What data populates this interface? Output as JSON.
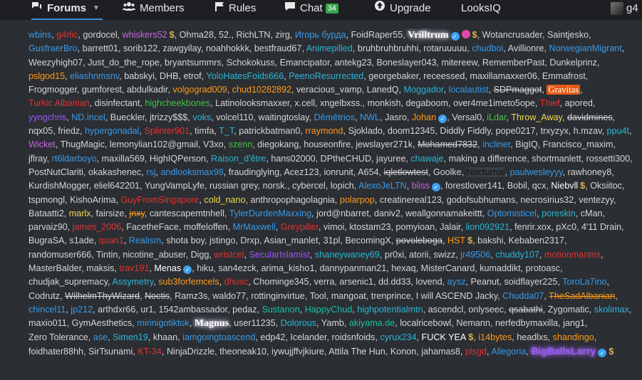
{
  "nav": {
    "items": [
      {
        "id": "forums",
        "label": "Forums",
        "icon": "chat-bubbles-icon"
      },
      {
        "id": "members",
        "label": "Members",
        "icon": "users-icon"
      },
      {
        "id": "rules",
        "label": "Rules",
        "icon": "flag-icon"
      },
      {
        "id": "chat",
        "label": "Chat",
        "icon": "comment-icon",
        "badge": "34"
      },
      {
        "id": "upgrade",
        "label": "Upgrade",
        "icon": "upload-icon"
      },
      {
        "id": "looksiq",
        "label": "LooksIQ"
      }
    ],
    "user_label": "g4"
  },
  "colors": {
    "blue": "#3a9ae8",
    "cyan": "#2ab7d6",
    "red": "#e5322f",
    "orange": "#ff9a1a",
    "yellow": "#f2d94e",
    "purple": "#9b59f5",
    "pink": "#c568dd",
    "green": "#43c04a",
    "teal": "#17c0a7",
    "grey": "#d6d6d6"
  },
  "online": [
    {
      "t": "wbins",
      "c": "blue"
    },
    {
      "t": "g4rlic",
      "c": "red"
    },
    {
      "t": "gordocel",
      "c": "grey"
    },
    {
      "t": "whiskers52",
      "c": "pink",
      "dollar": true
    },
    {
      "t": "Ohma28",
      "c": "grey"
    },
    {
      "t": "52.",
      "c": "grey"
    },
    {
      "t": "RichLTN",
      "c": "grey"
    },
    {
      "t": "zirg",
      "c": "grey"
    },
    {
      "t": "Игорь бурда",
      "c": "blue"
    },
    {
      "t": "FoidRaper55",
      "c": "grey"
    },
    {
      "t": "Vrilltrum",
      "c": "white",
      "glow": true,
      "verified": true,
      "dot": true,
      "dollar": true
    },
    {
      "t": "Wotancrusader",
      "c": "grey"
    },
    {
      "t": "Saintjesko",
      "c": "grey"
    },
    {
      "t": "GusfraerBro",
      "c": "blue"
    },
    {
      "t": "barrett01",
      "c": "grey"
    },
    {
      "t": "sorib122",
      "c": "grey"
    },
    {
      "t": "zawgyilay",
      "c": "grey"
    },
    {
      "t": "noahhokkk",
      "c": "grey"
    },
    {
      "t": "bestfraud67",
      "c": "grey"
    },
    {
      "t": "Animepilled",
      "c": "cyan"
    },
    {
      "t": "bruhbruhbruhhi",
      "c": "grey"
    },
    {
      "t": "rotaruuuuu",
      "c": "grey"
    },
    {
      "t": "chudboi",
      "c": "blue"
    },
    {
      "t": "Avillionre",
      "c": "grey"
    },
    {
      "t": "NorwegianMigrant",
      "c": "blue"
    },
    {
      "t": "Weezyhigh07",
      "c": "grey"
    },
    {
      "t": "Just_do_the_rope",
      "c": "grey"
    },
    {
      "t": "bryantsummrs",
      "c": "grey"
    },
    {
      "t": "Schokokuss",
      "c": "grey"
    },
    {
      "t": "Emancipator",
      "c": "grey"
    },
    {
      "t": "antekg23",
      "c": "grey"
    },
    {
      "t": "Boneslayer043",
      "c": "grey"
    },
    {
      "t": "mitereew",
      "c": "grey"
    },
    {
      "t": "RememberPast",
      "c": "grey"
    },
    {
      "t": "Dunkelprinz",
      "c": "grey"
    },
    {
      "t": "pslgod15",
      "c": "orange"
    },
    {
      "t": "eliashnmsnv",
      "c": "blue"
    },
    {
      "t": "babskyi",
      "c": "grey"
    },
    {
      "t": "DHB",
      "c": "grey"
    },
    {
      "t": "etrof",
      "c": "grey"
    },
    {
      "t": "YoloHatesFoids666",
      "c": "cyan"
    },
    {
      "t": "PeenoResurrected",
      "c": "cyan"
    },
    {
      "t": "georgebaker",
      "c": "grey"
    },
    {
      "t": "receessed",
      "c": "grey"
    },
    {
      "t": "maxillamaxxer06",
      "c": "grey"
    },
    {
      "t": "Emmafrost",
      "c": "grey"
    },
    {
      "t": "Frogmogger",
      "c": "grey"
    },
    {
      "t": "gumforest",
      "c": "grey"
    },
    {
      "t": "abdulkadir",
      "c": "grey"
    },
    {
      "t": "volgograd009",
      "c": "orange"
    },
    {
      "t": "chud10282892",
      "c": "orange"
    },
    {
      "t": "veracious_vamp",
      "c": "grey"
    },
    {
      "t": "LanedQ",
      "c": "grey"
    },
    {
      "t": "Moggador",
      "c": "cyan"
    },
    {
      "t": "localautist",
      "c": "blue"
    },
    {
      "t": "SDPmaggot",
      "c": "grey",
      "strike": true
    },
    {
      "t": "Gravitas",
      "c": "white",
      "gravitas": true
    },
    {
      "t": "Turkic Albanian",
      "c": "red"
    },
    {
      "t": "disinfectant",
      "c": "grey"
    },
    {
      "t": "highcheekbones",
      "c": "green"
    },
    {
      "t": "Latinolooksmaxxer",
      "c": "grey"
    },
    {
      "t": "x.cell",
      "c": "grey"
    },
    {
      "t": "xngelbxss.",
      "c": "grey"
    },
    {
      "t": "monkish",
      "c": "grey"
    },
    {
      "t": "degaboom",
      "c": "grey"
    },
    {
      "t": "over4me1imeto5ope",
      "c": "grey"
    },
    {
      "t": "Thief",
      "c": "red"
    },
    {
      "t": "apored",
      "c": "grey"
    },
    {
      "t": "yyngchris",
      "c": "purple"
    },
    {
      "t": "ND.incel",
      "c": "blue"
    },
    {
      "t": "Bueckler",
      "c": "grey"
    },
    {
      "t": "jtrizzy$$$",
      "c": "grey"
    },
    {
      "t": "voks",
      "c": "cyan"
    },
    {
      "t": "volcel110",
      "c": "grey"
    },
    {
      "t": "waitingtoslay",
      "c": "grey"
    },
    {
      "t": "Dēmētrios",
      "c": "blue"
    },
    {
      "t": "NWL",
      "c": "blue"
    },
    {
      "t": "Jasro",
      "c": "grey"
    },
    {
      "t": "Johan",
      "c": "orange",
      "verified": true
    },
    {
      "t": "Versal0",
      "c": "grey"
    },
    {
      "t": "iLdar",
      "c": "green"
    },
    {
      "t": "Throw_Away",
      "c": "yellow"
    },
    {
      "t": "davidmines",
      "c": "grey",
      "strike": true
    },
    {
      "t": "nqx05",
      "c": "grey"
    },
    {
      "t": "friedz",
      "c": "grey"
    },
    {
      "t": "hypergonadal",
      "c": "blue"
    },
    {
      "t": "Splinter901",
      "c": "red"
    },
    {
      "t": "timfa",
      "c": "grey"
    },
    {
      "t": "T_T",
      "c": "cyan"
    },
    {
      "t": "patrickbatman0",
      "c": "grey"
    },
    {
      "t": "rraymond",
      "c": "orange"
    },
    {
      "t": "Sjoklado",
      "c": "grey"
    },
    {
      "t": "doom12345",
      "c": "grey"
    },
    {
      "t": "Diddly Fiddly",
      "c": "grey"
    },
    {
      "t": "pope0217",
      "c": "grey"
    },
    {
      "t": "trxyzyx",
      "c": "grey"
    },
    {
      "t": "h.mzav",
      "c": "grey"
    },
    {
      "t": "ppu4t",
      "c": "cyan"
    },
    {
      "t": "Wicket",
      "c": "pink"
    },
    {
      "t": "ThugMagic",
      "c": "grey"
    },
    {
      "t": "lemonylian102@gmail",
      "c": "grey"
    },
    {
      "t": "V3xo",
      "c": "grey"
    },
    {
      "t": "szenn",
      "c": "green"
    },
    {
      "t": "diegokang",
      "c": "grey"
    },
    {
      "t": "houseonfire",
      "c": "grey"
    },
    {
      "t": "jewslayer271k",
      "c": "grey"
    },
    {
      "t": "Mohamed7832",
      "c": "grey",
      "strike": true
    },
    {
      "t": "incliner",
      "c": "blue"
    },
    {
      "t": "BigIQ",
      "c": "grey"
    },
    {
      "t": "Francisco_maxim",
      "c": "grey"
    },
    {
      "t": "jflray",
      "c": "grey"
    },
    {
      "t": "rt6ldarboyo",
      "c": "blue"
    },
    {
      "t": "maxilla569",
      "c": "grey"
    },
    {
      "t": "HighIQPerson",
      "c": "grey"
    },
    {
      "t": "Raison_d'être",
      "c": "cyan"
    },
    {
      "t": "hans02000",
      "c": "grey"
    },
    {
      "t": "DPtheCHUD",
      "c": "grey"
    },
    {
      "t": "jayuree",
      "c": "grey"
    },
    {
      "t": "chawaje",
      "c": "cyan"
    },
    {
      "t": "making a difference",
      "c": "grey"
    },
    {
      "t": "shortmanlett",
      "c": "grey"
    },
    {
      "t": "rossetti300",
      "c": "grey"
    },
    {
      "t": "PostNutClariti",
      "c": "grey"
    },
    {
      "t": "okakashenec",
      "c": "grey"
    },
    {
      "t": "rsj",
      "c": "blue"
    },
    {
      "t": "andlooksmax98",
      "c": "blue"
    },
    {
      "t": "fraudinglying",
      "c": "grey"
    },
    {
      "t": "Acez123",
      "c": "grey"
    },
    {
      "t": "ionrunit",
      "c": "grey"
    },
    {
      "t": "A654",
      "c": "grey"
    },
    {
      "t": "iqletlowtest",
      "c": "grey",
      "strike": true
    },
    {
      "t": "Goolke",
      "c": "grey"
    },
    {
      "t": "Nocturnal",
      "c": "black"
    },
    {
      "t": "paulwesleyyy",
      "c": "blue"
    },
    {
      "t": "rawhoney8",
      "c": "grey"
    },
    {
      "t": "KurdishMogger",
      "c": "grey"
    },
    {
      "t": "eliel642201",
      "c": "grey"
    },
    {
      "t": "YungVampLyfe",
      "c": "grey"
    },
    {
      "t": "russian grey",
      "c": "grey"
    },
    {
      "t": "norsk.",
      "c": "grey"
    },
    {
      "t": "cybercel",
      "c": "grey"
    },
    {
      "t": "lopich",
      "c": "grey"
    },
    {
      "t": "AlexoJeLTN",
      "c": "blue"
    },
    {
      "t": "bliss",
      "c": "pink",
      "verified": true
    },
    {
      "t": "forestlover141",
      "c": "grey"
    },
    {
      "t": "Bobil",
      "c": "grey"
    },
    {
      "t": "qcx",
      "c": "grey"
    },
    {
      "t": "Niebvll",
      "c": "white",
      "dollar": true
    },
    {
      "t": "Oksiitoc",
      "c": "grey"
    },
    {
      "t": "tspmongl",
      "c": "grey"
    },
    {
      "t": "KishoArima",
      "c": "grey"
    },
    {
      "t": "GuyFromSingapore",
      "c": "red"
    },
    {
      "t": "cold_nano",
      "c": "yellow"
    },
    {
      "t": "anthropophagolagnia",
      "c": "grey"
    },
    {
      "t": "polarpop",
      "c": "orange"
    },
    {
      "t": "creatinereal123",
      "c": "grey"
    },
    {
      "t": "godofsubhumans",
      "c": "grey"
    },
    {
      "t": "necrosirius32",
      "c": "grey"
    },
    {
      "t": "ventezyy",
      "c": "grey"
    },
    {
      "t": "Bataatti2",
      "c": "grey"
    },
    {
      "t": "marlx",
      "c": "yellow"
    },
    {
      "t": "fairsize",
      "c": "grey"
    },
    {
      "t": "jnxy",
      "c": "orange",
      "strike": true
    },
    {
      "t": "cantescapemtnhell",
      "c": "grey"
    },
    {
      "t": "TylerDurdenMaxxing",
      "c": "blue"
    },
    {
      "t": "jord@nbarret",
      "c": "grey"
    },
    {
      "t": "daniv2",
      "c": "grey"
    },
    {
      "t": "weallgonnamakeittt",
      "c": "grey"
    },
    {
      "t": "Optomisticel",
      "c": "blue"
    },
    {
      "t": "poreskin",
      "c": "cyan"
    },
    {
      "t": "cMan",
      "c": "grey"
    },
    {
      "t": "parvaiz90",
      "c": "grey"
    },
    {
      "t": "james_2006",
      "c": "red"
    },
    {
      "t": "FacetheFace",
      "c": "grey"
    },
    {
      "t": "moffeloffen",
      "c": "grey"
    },
    {
      "t": "MrMaxwell",
      "c": "blue"
    },
    {
      "t": "Greypiller",
      "c": "red"
    },
    {
      "t": "vimoi",
      "c": "grey"
    },
    {
      "t": "ktostam23",
      "c": "grey"
    },
    {
      "t": "pomyioan",
      "c": "grey"
    },
    {
      "t": "Jalair",
      "c": "grey"
    },
    {
      "t": "lion092921",
      "c": "cyan"
    },
    {
      "t": "fenrir.xox",
      "c": "grey"
    },
    {
      "t": "pXc0",
      "c": "grey"
    },
    {
      "t": "4'11 Drain",
      "c": "grey"
    },
    {
      "t": "BugraSA",
      "c": "grey"
    },
    {
      "t": "s1ade",
      "c": "grey"
    },
    {
      "t": "quan1",
      "c": "red"
    },
    {
      "t": "Realism",
      "c": "blue"
    },
    {
      "t": "shota boy",
      "c": "grey"
    },
    {
      "t": "jstingo",
      "c": "grey"
    },
    {
      "t": "Drxp",
      "c": "grey"
    },
    {
      "t": "Asian_manlet",
      "c": "grey"
    },
    {
      "t": "31pl",
      "c": "grey"
    },
    {
      "t": "BecomingX",
      "c": "grey"
    },
    {
      "t": "povoleboga",
      "c": "grey",
      "strike": true
    },
    {
      "t": "HST",
      "c": "orange",
      "dollar": true
    },
    {
      "t": "bakshi",
      "c": "grey"
    },
    {
      "t": "Kebaben2317",
      "c": "grey"
    },
    {
      "t": "randomuser666",
      "c": "grey"
    },
    {
      "t": "Tintin",
      "c": "grey"
    },
    {
      "t": "nicotine_abuser",
      "c": "grey"
    },
    {
      "t": "Digg",
      "c": "grey"
    },
    {
      "t": "wristcel",
      "c": "red"
    },
    {
      "t": "SecularIslamist",
      "c": "purple"
    },
    {
      "t": "shaneywaney69",
      "c": "cyan"
    },
    {
      "t": "pr0xi",
      "c": "grey"
    },
    {
      "t": "atorii",
      "c": "grey"
    },
    {
      "t": "swizz",
      "c": "grey"
    },
    {
      "t": "jr49506",
      "c": "blue"
    },
    {
      "t": "chuddy107",
      "c": "cyan"
    },
    {
      "t": "motionmantris",
      "c": "red"
    },
    {
      "t": "MasterBalder",
      "c": "grey"
    },
    {
      "t": "maksis",
      "c": "grey"
    },
    {
      "t": "trav191",
      "c": "red"
    },
    {
      "t": "Menas",
      "c": "white",
      "verified": true
    },
    {
      "t": "hiku",
      "c": "grey"
    },
    {
      "t": "san4ezck",
      "c": "grey"
    },
    {
      "t": "arima_kisho1",
      "c": "grey"
    },
    {
      "t": "dannypanman21",
      "c": "grey"
    },
    {
      "t": "hexaq",
      "c": "grey"
    },
    {
      "t": "MisterCanard",
      "c": "grey"
    },
    {
      "t": "kumaddikt",
      "c": "grey"
    },
    {
      "t": "protoasc",
      "c": "grey"
    },
    {
      "t": "chudjak_supremacy",
      "c": "grey"
    },
    {
      "t": "Assymetry",
      "c": "cyan"
    },
    {
      "t": "sub3forfemcels",
      "c": "orange"
    },
    {
      "t": "dhusc",
      "c": "red"
    },
    {
      "t": "Chominge345",
      "c": "grey"
    },
    {
      "t": "verra",
      "c": "grey"
    },
    {
      "t": "arsenic1",
      "c": "grey"
    },
    {
      "t": "dd.dd33",
      "c": "grey"
    },
    {
      "t": "lovend",
      "c": "grey"
    },
    {
      "t": "aysz",
      "c": "blue"
    },
    {
      "t": "Peanut",
      "c": "grey"
    },
    {
      "t": "soidflayer225",
      "c": "grey"
    },
    {
      "t": "ToroLa7ino",
      "c": "blue"
    },
    {
      "t": "Codrutz",
      "c": "grey"
    },
    {
      "t": "WilhelmThyWizard",
      "c": "grey",
      "strike": true
    },
    {
      "t": "Noctis",
      "c": "grey",
      "strike": true
    },
    {
      "t": "Ramz3s",
      "c": "grey"
    },
    {
      "t": "waldo77",
      "c": "grey"
    },
    {
      "t": "rottinginvirtue",
      "c": "grey"
    },
    {
      "t": "Tool",
      "c": "grey"
    },
    {
      "t": "mangoat",
      "c": "grey"
    },
    {
      "t": "trenprince",
      "c": "grey"
    },
    {
      "t": "I will ASCEND Jacky",
      "c": "grey"
    },
    {
      "t": "Chudda07",
      "c": "blue"
    },
    {
      "t": "TheSadAlbanian",
      "c": "orange",
      "strike": true
    },
    {
      "t": "chincel11",
      "c": "blue"
    },
    {
      "t": "jp212",
      "c": "blue"
    },
    {
      "t": "arthdxr66",
      "c": "grey"
    },
    {
      "t": "ur1",
      "c": "grey"
    },
    {
      "t": "1542ambassador",
      "c": "grey"
    },
    {
      "t": "pedaz",
      "c": "grey"
    },
    {
      "t": "Sustanon",
      "c": "teal"
    },
    {
      "t": "HappyChud",
      "c": "teal"
    },
    {
      "t": "highpotentialmtn",
      "c": "cyan"
    },
    {
      "t": "ascendcl",
      "c": "grey"
    },
    {
      "t": "onlyseec",
      "c": "grey"
    },
    {
      "t": "qsabathi",
      "c": "grey",
      "strike": true
    },
    {
      "t": "Zygomatic",
      "c": "grey"
    },
    {
      "t": "skolimax",
      "c": "cyan"
    },
    {
      "t": "maxio011",
      "c": "grey"
    },
    {
      "t": "GymAesthetics",
      "c": "grey"
    },
    {
      "t": "mirinigotiktok",
      "c": "blue"
    },
    {
      "t": "Magnus",
      "c": "white",
      "glow": true
    },
    {
      "t": "user11235",
      "c": "grey"
    },
    {
      "t": "Dolorous",
      "c": "cyan"
    },
    {
      "t": "Yamb",
      "c": "grey"
    },
    {
      "t": "akiyama.de",
      "c": "teal"
    },
    {
      "t": "localricebowl",
      "c": "grey"
    },
    {
      "t": "Nemann",
      "c": "grey"
    },
    {
      "t": "nerfedbymaxilla",
      "c": "grey"
    },
    {
      "t": "jang1",
      "c": "grey"
    },
    {
      "t": "Zero Tolerance",
      "c": "grey"
    },
    {
      "t": "ase",
      "c": "blue"
    },
    {
      "t": "Simen19",
      "c": "cyan"
    },
    {
      "t": "khaan",
      "c": "grey"
    },
    {
      "t": "iamgoingtoascend",
      "c": "blue"
    },
    {
      "t": "edp42",
      "c": "grey"
    },
    {
      "t": "Icelander",
      "c": "grey"
    },
    {
      "t": "roidsnfoids",
      "c": "grey"
    },
    {
      "t": "cyrux234",
      "c": "cyan"
    },
    {
      "t": "FUCK YEA",
      "c": "white",
      "dollar": true
    },
    {
      "t": "i14bytes",
      "c": "orange"
    },
    {
      "t": "headlxs",
      "c": "grey"
    },
    {
      "t": "shandingo",
      "c": "orange"
    },
    {
      "t": "foidhater88hh",
      "c": "grey"
    },
    {
      "t": "SirTsunami",
      "c": "grey"
    },
    {
      "t": "KT-34",
      "c": "red"
    },
    {
      "t": "NinjaDrizzle",
      "c": "grey"
    },
    {
      "t": "theoneak10",
      "c": "grey"
    },
    {
      "t": "iywujjffvjkiure",
      "c": "grey"
    },
    {
      "t": "Attila The Hun",
      "c": "grey"
    },
    {
      "t": "Konon",
      "c": "grey"
    },
    {
      "t": "jahamas8",
      "c": "grey"
    },
    {
      "t": "plsgd",
      "c": "red"
    },
    {
      "t": "Allegoria",
      "c": "blue"
    },
    {
      "t": "BigBallsLarry",
      "c": "purple",
      "glow": true,
      "verified": true,
      "dollar": true
    }
  ]
}
